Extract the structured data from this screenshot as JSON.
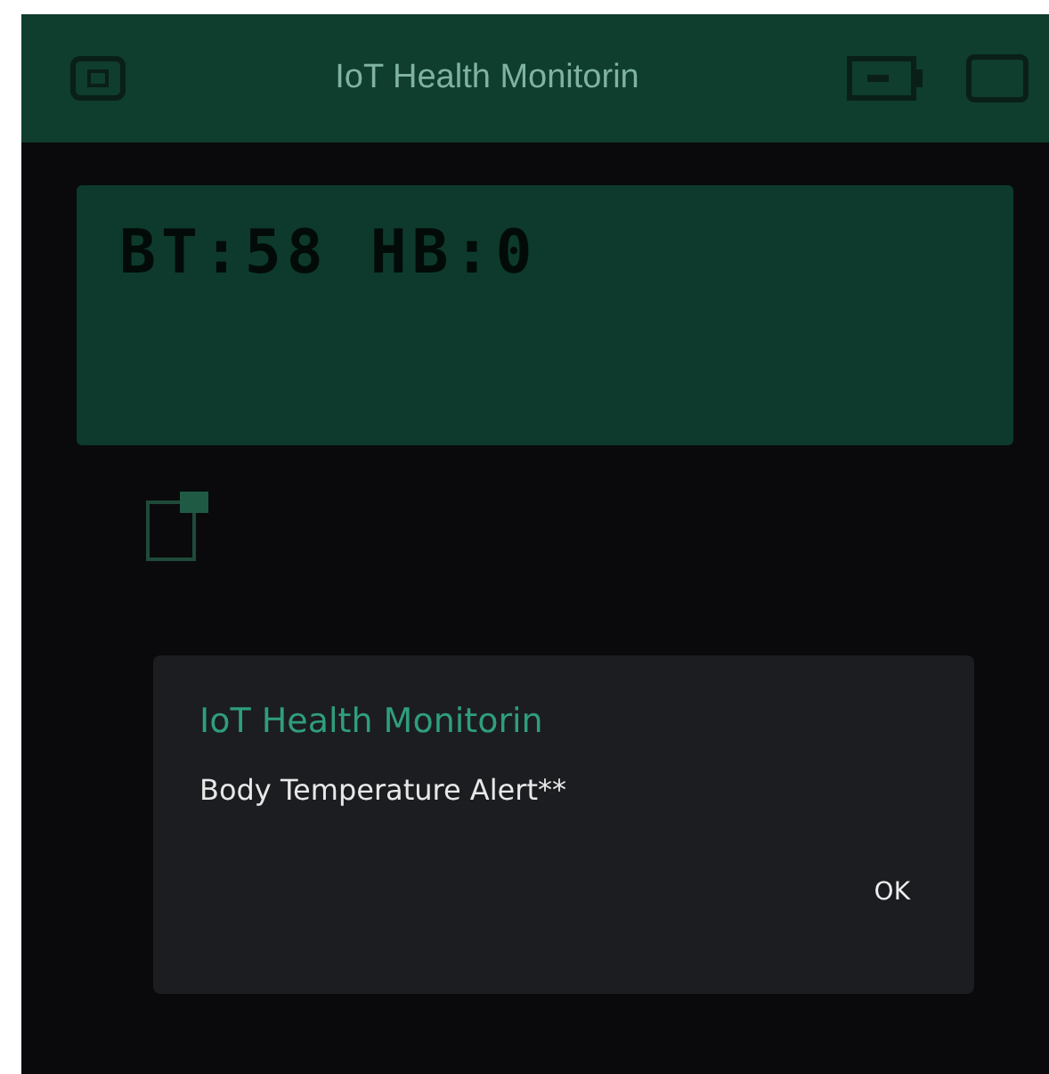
{
  "header": {
    "title": "IoT Health Monitorin"
  },
  "lcd": {
    "text": "BT:58 HB:0"
  },
  "dialog": {
    "title": "IoT Health Monitorin",
    "message": "Body Temperature Alert**",
    "buttons": [
      "OK"
    ]
  }
}
